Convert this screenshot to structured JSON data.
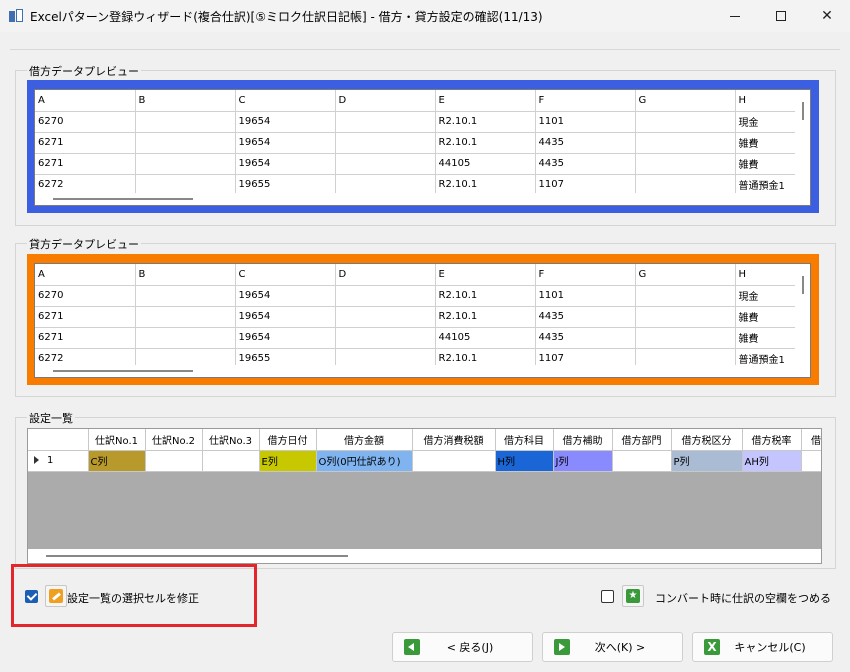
{
  "window": {
    "title": "Excelパターン登録ウィザード(複合仕訳)[⑤ミロク仕訳日記帳] - 借方・貸方設定の確認(11/13)",
    "minimize_label": "—",
    "maximize_label": "☐",
    "close_label": "✕"
  },
  "debit_preview": {
    "title": "借方データプレビュー",
    "frame_color": "#3c5ee0",
    "columns": [
      "A",
      "B",
      "C",
      "D",
      "E",
      "F",
      "G",
      "H"
    ],
    "rows": [
      [
        "6270",
        "",
        "19654",
        "",
        "R2.10.1",
        "1101",
        "",
        "現金"
      ],
      [
        "6271",
        "",
        "19654",
        "",
        "R2.10.1",
        "4435",
        "",
        "雑費"
      ],
      [
        "6271",
        "",
        "19654",
        "",
        "44105",
        "4435",
        "",
        "雑費"
      ],
      [
        "6272",
        "",
        "19655",
        "",
        "R2.10.1",
        "1107",
        "",
        "普通預金1"
      ]
    ]
  },
  "credit_preview": {
    "title": "貸方データプレビュー",
    "frame_color": "#f77c00",
    "columns": [
      "A",
      "B",
      "C",
      "D",
      "E",
      "F",
      "G",
      "H"
    ],
    "rows": [
      [
        "6270",
        "",
        "19654",
        "",
        "R2.10.1",
        "1101",
        "",
        "現金"
      ],
      [
        "6271",
        "",
        "19654",
        "",
        "R2.10.1",
        "4435",
        "",
        "雑費"
      ],
      [
        "6271",
        "",
        "19654",
        "",
        "44105",
        "4435",
        "",
        "雑費"
      ],
      [
        "6272",
        "",
        "19655",
        "",
        "R2.10.1",
        "1107",
        "",
        "普通預金1"
      ]
    ]
  },
  "settings": {
    "title": "設定一覧",
    "columns": [
      "",
      "仕訳No.1",
      "仕訳No.2",
      "仕訳No.3",
      "借方日付",
      "借方金額",
      "借方消費税額",
      "借方科目",
      "借方補助",
      "借方部門",
      "借方税区分",
      "借方税率",
      "借"
    ],
    "row": {
      "index": "1",
      "cells": [
        "C列",
        "",
        "",
        "E列",
        "O列(0円仕訳あり)",
        "",
        "H列",
        "J列",
        "",
        "P列",
        "AH列",
        ""
      ],
      "colors": [
        "#b89a2c",
        "#ffffff",
        "#ffffff",
        "#c8c800",
        "#7fb4f0",
        "#ffffff",
        "#1a66d6",
        "#8a8aff",
        "#ffffff",
        "#a9bcd4",
        "#c4c4ff",
        "#ffffff"
      ]
    }
  },
  "options": {
    "edit_selected_label": "設定一覧の選択セルを修正",
    "edit_selected_checked": true,
    "compress_blank_label": "コンバート時に仕訳の空欄をつめる",
    "compress_blank_checked": false
  },
  "buttons": {
    "back": "< 戻る(J)",
    "next": "次へ(K) >",
    "cancel": "キャンセル(C)"
  }
}
